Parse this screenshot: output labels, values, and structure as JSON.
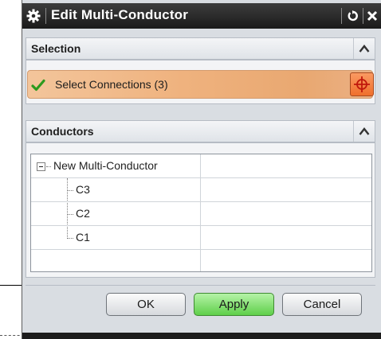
{
  "background": {
    "fragment_text": "- - - ...."
  },
  "dialog": {
    "title": "Edit Multi-Conductor",
    "icons": {
      "settings": "gear-icon",
      "reset": "reset-icon",
      "close": "close-icon"
    }
  },
  "selection": {
    "header": "Selection",
    "label": "Select Connections (3)",
    "status_icon": "checkmark-icon",
    "action_icon": "crosshair-icon"
  },
  "conductors": {
    "header": "Conductors",
    "tree": {
      "root": "New Multi-Conductor",
      "children": [
        "C3",
        "C2",
        "C1"
      ]
    }
  },
  "buttons": {
    "ok": "OK",
    "apply": "Apply",
    "cancel": "Cancel"
  },
  "colors": {
    "titlebar": "#1a1a1a",
    "selection_row": "#efb27e",
    "action_button": "#ef6f2c",
    "apply_button": "#5fcf4a"
  }
}
